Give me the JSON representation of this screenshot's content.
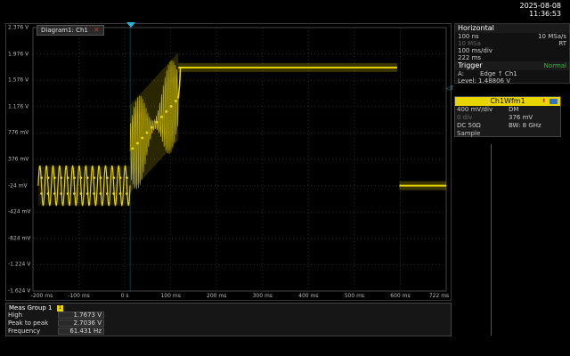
{
  "datetime": {
    "date": "2025-08-08",
    "time": "11:36:53"
  },
  "diagram": {
    "tab_label": "Diagram1: Ch1",
    "close_symbol": "✕",
    "right_marker": "◁T",
    "y_labels": [
      "2.376 V",
      "1.976 V",
      "1.576 V",
      "1.176 V",
      "776 mV",
      "376 mV",
      "-24 mV",
      "-424 mV",
      "-824 mV",
      "-1.224 V",
      "-1.624 V"
    ],
    "x_labels": [
      "-200 ms",
      "-100 ms",
      "0 s",
      "100 ms",
      "200 ms",
      "300 ms",
      "400 ms",
      "500 ms",
      "600 ms",
      "722 ms"
    ],
    "trace_color": "#e8d500"
  },
  "horizontal": {
    "title": "Horizontal",
    "rows": [
      {
        "left": "100 ns",
        "right": "10 MSa/s"
      },
      {
        "left": "10 MSa",
        "right": "RT"
      },
      {
        "left": "100 ms/div",
        "right": ""
      },
      {
        "left": "222 ms",
        "right": ""
      }
    ]
  },
  "trigger": {
    "title": "Trigger",
    "mode": "Normal",
    "row1_left": "A:",
    "row1_mid": "Edge ↑ Ch1",
    "level": "Level: 1.48806 V"
  },
  "waveform": {
    "title": "Ch1Wfm1",
    "arrows": "⬍",
    "rows": [
      {
        "a": "400 mV/div",
        "b": "DM"
      },
      {
        "a": "0 div",
        "b": "376 mV"
      },
      {
        "a": "DC 50Ω",
        "b": "BW: 8 GHz"
      },
      {
        "a": "Sample",
        "b": ""
      }
    ]
  },
  "measurements": {
    "title": "Meas Group 1",
    "badge": "1",
    "rows": [
      {
        "label": "High",
        "value": "1.7673 V"
      },
      {
        "label": "Peak to peak",
        "value": "2.7036 V"
      },
      {
        "label": "Frequency",
        "value": "61.431 Hz"
      }
    ]
  },
  "chart_data": {
    "type": "line",
    "xlim": [
      -222,
      722
    ],
    "ylim": [
      -1.624,
      2.376
    ],
    "x_unit": "ms",
    "y_unit": "V",
    "segments": [
      {
        "x_start": -210,
        "x_end": 0,
        "shape": "sine",
        "center": -0.024,
        "amplitude": 0.3,
        "cycles": 14
      },
      {
        "x_start": 0,
        "x_end": 110,
        "shape": "rising-oscillation",
        "start": 0.5,
        "end": 1.3,
        "envelope": 0.7
      },
      {
        "x_start": 110,
        "x_end": 610,
        "shape": "plateau",
        "level": 1.77
      },
      {
        "x_start": 615,
        "x_end": 722,
        "shape": "plateau",
        "level": -0.024
      }
    ]
  }
}
